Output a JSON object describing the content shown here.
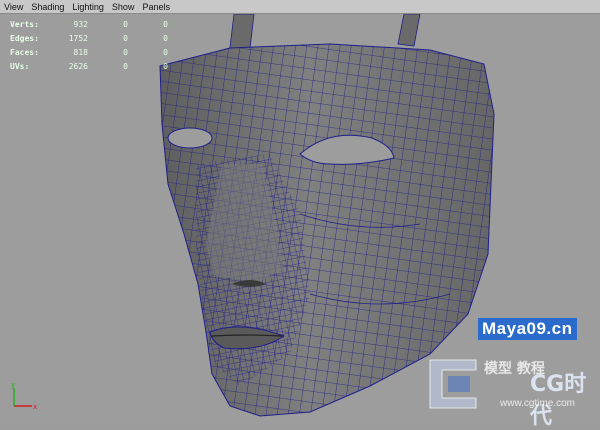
{
  "menubar": {
    "items": [
      "View",
      "Shading",
      "Lighting",
      "Show",
      "Panels"
    ]
  },
  "hud": {
    "rows": [
      {
        "label": "Verts:",
        "value": "932",
        "sub1": "0",
        "sub2": "0"
      },
      {
        "label": "Edges:",
        "value": "1752",
        "sub1": "0",
        "sub2": "0"
      },
      {
        "label": "Faces:",
        "value": "818",
        "sub1": "0",
        "sub2": "0"
      },
      {
        "label": "UVs:",
        "value": "2626",
        "sub1": "0",
        "sub2": "0"
      }
    ]
  },
  "axis": {
    "x": "x",
    "y": "y"
  },
  "watermark": {
    "site": "Maya09.cn",
    "line1": "模型 教程",
    "brand": "CG时代",
    "url": "www.cgtime.com"
  },
  "colors": {
    "viewport": "#9d9d9d",
    "mesh_fill": "#6e6e6e",
    "wire": "#1e1e8c",
    "hud_text": "#e6ffe6"
  }
}
